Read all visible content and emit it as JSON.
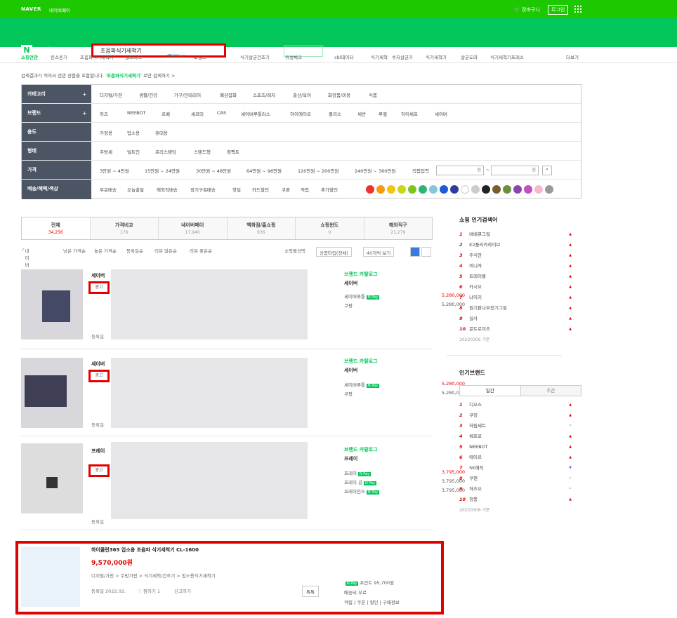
{
  "header": {
    "naver": "NAVER",
    "npay": "네이버페이",
    "cart": "장바구니",
    "login": "로그인",
    "shop": "쇼핑",
    "shoplive": "쇼핑LIVE",
    "search_value": "초음파식기세척기",
    "detail": "상세검색",
    "catmore": "카테고리 더보기",
    "best": "쇼핑BEST",
    "all": "전체보기",
    "my": "쇼핑MY"
  },
  "nav": [
    "쇼핑연관",
    "린스튼기",
    "초음파식기세척기",
    "밀도비드",
    "dfb22wo",
    "화실드",
    "식기살균건조기",
    "위생체크",
    "cbl데이터",
    "식기세척",
    "수저살균기",
    "식기세척기",
    "살균도마",
    "식기세척기프레스",
    "더보기"
  ],
  "notice": {
    "text": "검색결과가 적어서 연관 상품을 포함합니다.",
    "keyword": "'초음파식기세척기'",
    "suffix": "로만 검색하기 >"
  },
  "filter": {
    "category": {
      "label": "카테고리",
      "items": [
        "디지털/가전",
        "생활/건강",
        "가구/인테리어",
        "패션잡화",
        "스포츠/레저",
        "출산/육아",
        "화장품/미용",
        "식품"
      ]
    },
    "brand": {
      "label": "브랜드",
      "items": [
        "하츠",
        "NEEBOT",
        "르베",
        "세르미",
        "CAS",
        "세이버루틀러스",
        "하이에이르",
        "플리소",
        "세반",
        "루엘",
        "하이셰프",
        "세이버"
      ]
    },
    "type": {
      "label": "용도",
      "items": [
        "가정용",
        "업소용",
        "휴대용"
      ]
    },
    "shape": {
      "label": "형태",
      "items": [
        "주방세",
        "빌트인",
        "프리스탠딩",
        "스탠드형",
        "컴팩트"
      ]
    },
    "price": {
      "label": "가격",
      "items": [
        "3만원 ~ 4만원",
        "15만원 ~ 24만원",
        "30만원 ~ 48만원",
        "64만원 ~ 96만원",
        "120만원 ~ 200만원",
        "240만원 ~ 360만원",
        "직접입력"
      ],
      "unit": "원"
    },
    "delivery": {
      "label": "배송/혜택/색상",
      "items": [
        "무료배송",
        "오늘출발",
        "해외직배송",
        "정기구독배송",
        "핫딜",
        "카드할인",
        "쿠폰",
        "적립",
        "추가할인"
      ]
    },
    "colors": [
      "#e33",
      "#f39c12",
      "#f1c40f",
      "#c6d816",
      "#7cc61c",
      "#2bb673",
      "#86c5e0",
      "#1e5bd8",
      "#2c3e9a",
      "#ffffff",
      "#cccccc",
      "#222222",
      "#7a5c2e",
      "#6a8f3e",
      "#8e44ad",
      "#c44fbf",
      "#f5b8d0",
      "#999999"
    ]
  },
  "tabs": [
    {
      "t": "전체",
      "c": "34,256"
    },
    {
      "t": "가격비교",
      "c": "176"
    },
    {
      "t": "네이버페이",
      "c": "17,940"
    },
    {
      "t": "백화점/홈쇼핑",
      "c": "936"
    },
    {
      "t": "쇼핑윈도",
      "c": "0"
    },
    {
      "t": "해외직구",
      "c": "21,279"
    }
  ],
  "sort": {
    "items": [
      "네이버 랭킹순",
      "낮은 가격순",
      "높은 가격순",
      "등록일순",
      "리뷰 많은순",
      "리뷰 좋은순"
    ],
    "select1": "상품타입(전체)",
    "select2": "40개씩 보기",
    "checkout": "쇼핑몰선택"
  },
  "items": [
    {
      "title": "세이버",
      "ad": "광고",
      "store_g": "브랜드 카탈로그",
      "store": "세이버",
      "mall1": "세이버루틀",
      "price1": "5,280,000",
      "mall2": "쿠팡",
      "price2": "5,280,000",
      "reg": "등록일"
    },
    {
      "title": "세이버",
      "ad": "광고",
      "store_g": "브랜드 카탈로그",
      "store": "세이버",
      "mall1": "세이버루틀",
      "price1": "5,280,000",
      "mall2": "쿠팡",
      "price2": "5,280,000",
      "reg": "등록일"
    },
    {
      "title": "프레이",
      "ad": "광고",
      "store_g": "브랜드 카탈로그",
      "store": "프레이",
      "mall1": "프레이",
      "price1": "3,795,000",
      "mall2": "프레이 공",
      "price2": "3,795,000",
      "mall3": "프레이인스",
      "price3": "3,795,000",
      "reg": "등록일"
    }
  ],
  "last": {
    "title": "하이클린365 업소용 초음파 식기세척기 CL-1600",
    "price": "9,570,000원",
    "cat": "디지털/가전 > 주방가전 > 식기세척/건조기 > 업소용식기세척기",
    "reg": "등록일 2022.02.",
    "zzim": "찜하기 1",
    "report": "신고하기",
    "talk": "톡톡",
    "point": "포인트 95,700원",
    "ship": "배송비 무료",
    "tags": "적립 | 쿠폰 | 할인 | 구매정보"
  },
  "aside": {
    "popular_title": "쇼핑 인기검색어",
    "popular": [
      {
        "r": "1",
        "n": "바베큐그릴",
        "a": "▲"
      },
      {
        "r": "2",
        "n": "K2플리카하이브",
        "a": "▲"
      },
      {
        "r": "3",
        "n": "주식잔",
        "a": "▲"
      },
      {
        "r": "4",
        "n": "미니카",
        "a": "▲"
      },
      {
        "r": "5",
        "n": "트레이볼",
        "a": "▲"
      },
      {
        "r": "6",
        "n": "카시오",
        "a": "▲"
      },
      {
        "r": "7",
        "n": "나이키",
        "a": "▲"
      },
      {
        "r": "8",
        "n": "원기판나무전기그릴",
        "a": "▲"
      },
      {
        "r": "9",
        "n": "실사",
        "a": "▲"
      },
      {
        "r": "10",
        "n": "콘트로이츠",
        "a": "▲"
      }
    ],
    "popular_date": "20220306 기준",
    "brand_title": "인기브랜드",
    "brand_tab1": "일간",
    "brand_tab2": "주간",
    "brands": [
      {
        "r": "1",
        "n": "디오스",
        "a": "▲",
        "c": "up"
      },
      {
        "r": "2",
        "n": "쿠킹",
        "a": "▲",
        "c": "up"
      },
      {
        "r": "3",
        "n": "하림세트",
        "a": "=",
        "c": "same"
      },
      {
        "r": "4",
        "n": "쉐프로",
        "a": "▲",
        "c": "up"
      },
      {
        "r": "5",
        "n": "NEEBOT",
        "a": "▲",
        "c": "up"
      },
      {
        "r": "6",
        "n": "에이르",
        "a": "▲",
        "c": "up"
      },
      {
        "r": "7",
        "n": "SK매직",
        "a": "▼",
        "c": "down"
      },
      {
        "r": "8",
        "n": "쿠첸",
        "a": "=",
        "c": "same"
      },
      {
        "r": "9",
        "n": "하츠오",
        "a": "=",
        "c": "same"
      },
      {
        "r": "10",
        "n": "청풍",
        "a": "▲",
        "c": "up"
      }
    ],
    "brand_date": "20220306 기준"
  }
}
